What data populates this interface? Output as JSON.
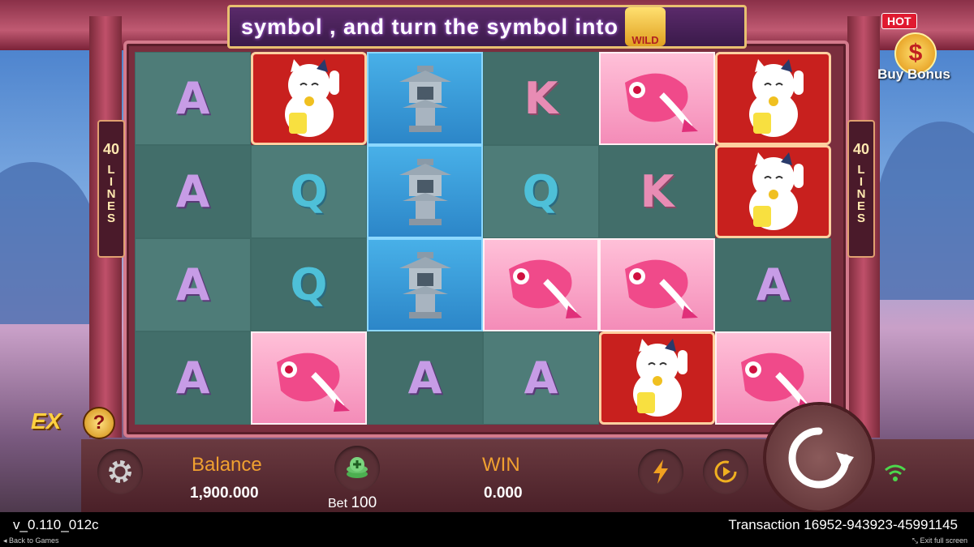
{
  "banner": {
    "text": "symbol , and turn the symbol into",
    "wild_label": "WILD"
  },
  "lines_panel": {
    "count": "40",
    "word": "LINES"
  },
  "buy_bonus": {
    "hot": "HOT",
    "icon": "dollar-coin-icon",
    "coin_glyph": "$",
    "label": "Buy Bonus"
  },
  "ex": {
    "label": "EX",
    "help": "?"
  },
  "reels": [
    [
      "A",
      "cat",
      "lantern",
      "K",
      "koi",
      "cat"
    ],
    [
      "A",
      "Q",
      "lantern",
      "Q",
      "K",
      "cat"
    ],
    [
      "A",
      "Q",
      "lantern",
      "koi",
      "koi",
      "A"
    ],
    [
      "A",
      "koi",
      "A",
      "A",
      "cat",
      "koi"
    ]
  ],
  "bottom_bar": {
    "balance_label": "Balance",
    "balance_value": "1,900.000",
    "bet_label": "Bet",
    "bet_value": "100",
    "win_label": "WIN",
    "win_value": "0.000"
  },
  "footer": {
    "version": "v_0.110_012c",
    "back": "Back to Games",
    "transaction": "Transaction 16952-943923-45991145",
    "exit_fullscreen": "Exit full screen"
  }
}
